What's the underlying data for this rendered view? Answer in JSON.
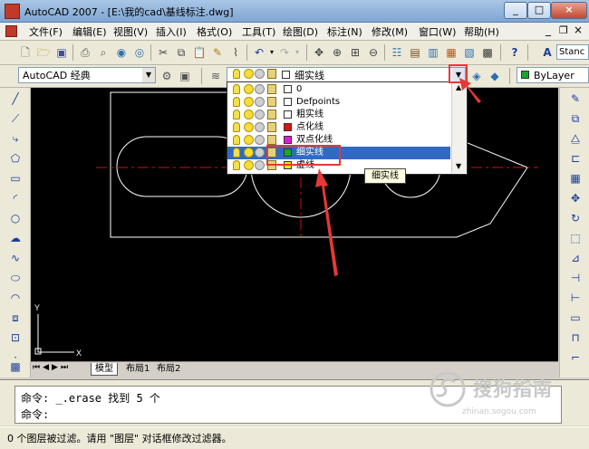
{
  "window": {
    "title": "AutoCAD 2007 - [E:\\我的cad\\基线标注.dwg]",
    "controls": [
      "_",
      "□",
      "×"
    ]
  },
  "menus": [
    "文件(F)",
    "编辑(E)",
    "视图(V)",
    "插入(I)",
    "格式(O)",
    "工具(T)",
    "绘图(D)",
    "标注(N)",
    "修改(M)",
    "窗口(W)",
    "帮助(H)"
  ],
  "toolbar": {
    "style_text": "Stanc"
  },
  "workspace": {
    "value": "AutoCAD 经典"
  },
  "layer": {
    "current": "细实线",
    "bylayer": "ByLayer",
    "items": [
      {
        "name": "0",
        "color": "#ffffff"
      },
      {
        "name": "Defpoints",
        "color": "#ffffff"
      },
      {
        "name": "粗实线",
        "color": "#ffffff"
      },
      {
        "name": "点化线",
        "color": "#dd1111"
      },
      {
        "name": "双点化线",
        "color": "#e21ad8"
      },
      {
        "name": "细实线",
        "color": "#1aa531"
      },
      {
        "name": "虚线",
        "color": "#f2e300"
      }
    ],
    "selected_index": 5,
    "tooltip": "细实线"
  },
  "drawing": {
    "ucs_x": "X",
    "ucs_y": "Y",
    "line_color": "#ffffff",
    "center_color": "#cc1111"
  },
  "tabs": [
    "模型",
    "布局1",
    "布局2"
  ],
  "command": {
    "line1": "命令: _.erase 找到 5 个",
    "line2": "命令:"
  },
  "status": {
    "text": "0 个图层被过滤。请用 \"图层\" 对话框修改过滤器。"
  },
  "watermark": {
    "name": "搜狗指南",
    "url": "zhinan.sogou.com"
  }
}
